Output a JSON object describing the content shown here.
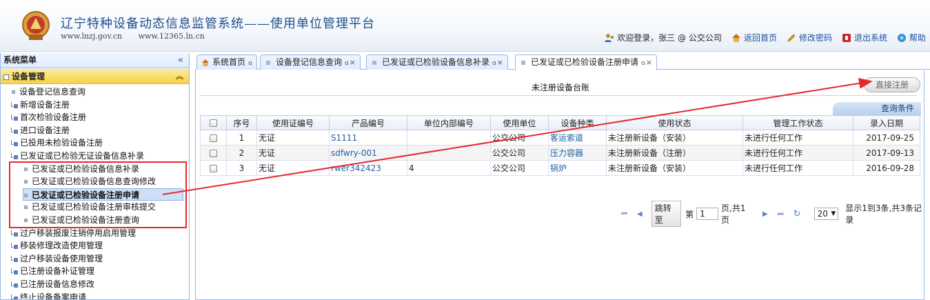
{
  "header": {
    "title": "辽宁特种设备动态信息监管系统——使用单位管理平台",
    "url1": "www.lnzj.gov.cn",
    "url2": "www.12365.ln.cn",
    "welcome": "欢迎登录，张三 @ 公交公司",
    "home": "返回首页",
    "change_pwd": "修改密码",
    "logout": "退出系统",
    "help": "帮助"
  },
  "sidebar": {
    "title": "系统菜单",
    "collapse": "«",
    "group": "设备管理",
    "items": [
      {
        "label": "设备登记信息查询",
        "type": "leaf"
      },
      {
        "label": "新增设备注册",
        "type": "fold"
      },
      {
        "label": "首次检验设备注册",
        "type": "fold"
      },
      {
        "label": "进口设备注册",
        "type": "fold"
      },
      {
        "label": "已投用未检验设备注册",
        "type": "fold"
      },
      {
        "label": "已发证或已检验无证设备信息补录",
        "type": "fold"
      },
      {
        "label": "已发证或已检验设备信息补录",
        "type": "sub"
      },
      {
        "label": "已发证或已检验设备信息查询修改",
        "type": "sub"
      },
      {
        "label": "已发证或已检验设备注册申请",
        "type": "sel"
      },
      {
        "label": "已发证或已检验设备注册审核提交",
        "type": "sub"
      },
      {
        "label": "已发证或已检验设备注册查询",
        "type": "sub"
      },
      {
        "label": "过户移装报废注销停用启用管理",
        "type": "fold"
      },
      {
        "label": "移装修理改造使用管理",
        "type": "fold"
      },
      {
        "label": "过户移装设备使用管理",
        "type": "fold"
      },
      {
        "label": "已注册设备补证管理",
        "type": "fold"
      },
      {
        "label": "已注册设备信息修改",
        "type": "fold"
      },
      {
        "label": "终止设备备案申请",
        "type": "fold"
      }
    ]
  },
  "tabs": [
    {
      "label": "系统首页",
      "pin": "ɑ"
    },
    {
      "label": "设备登记信息查询",
      "pin": "ɑ",
      "close": "×"
    },
    {
      "label": "已发证或已检验设备信息补录",
      "pin": "ɑ",
      "close": "×"
    },
    {
      "label": "已发证或已检验设备注册申请",
      "pin": "ɑ",
      "close": "×"
    }
  ],
  "main": {
    "ledger_title": "未注册设备台账",
    "direct_register": "直接注册",
    "query_conditions": "查询条件"
  },
  "table": {
    "headers": [
      "序号",
      "使用证编号",
      "产品编号",
      "单位内部编号",
      "使用单位",
      "设备种类",
      "使用状态",
      "管理工作状态",
      "录入日期"
    ],
    "rows": [
      [
        "1",
        "无证",
        "S1111",
        "",
        "公交公司",
        "客运索道",
        "未注册新设备（安装）",
        "未进行任何工作",
        "2017-09-25"
      ],
      [
        "2",
        "无证",
        "sdfwry-001",
        "",
        "公交公司",
        "压力容器",
        "未注册新设备（注册）",
        "未进行任何工作",
        "2017-09-13"
      ],
      [
        "3",
        "无证",
        "rwer342423",
        "4",
        "公交公司",
        "锅炉",
        "未注册新设备（安装）",
        "未进行任何工作",
        "2016-09-28"
      ]
    ]
  },
  "pager": {
    "first": "⏮",
    "prev": "◀",
    "jump": "跳转至",
    "page_prefix": "第",
    "page_value": "1",
    "page_suffix": "页,共1页",
    "next": "▶",
    "last": "⏭",
    "refresh": "↻",
    "page_size": "20",
    "summary": "显示1到3条,共3条记录"
  },
  "colors": {
    "accent": "#1e4d8c",
    "annotation_red": "#e3282c",
    "menu_selected": "#cde0f7",
    "group_yellow": "#f7d24c"
  }
}
